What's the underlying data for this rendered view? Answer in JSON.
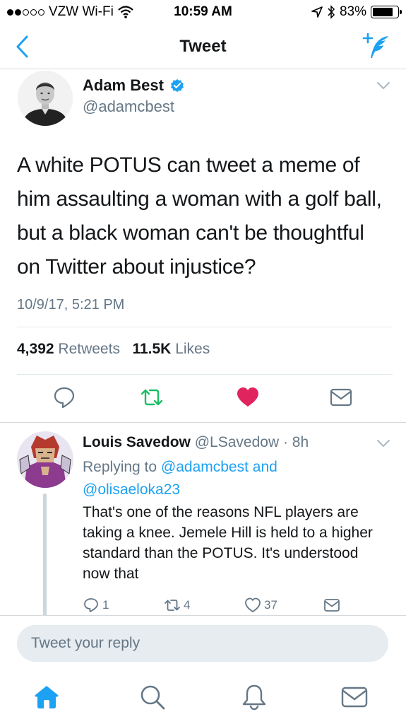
{
  "status_bar": {
    "carrier": "VZW Wi-Fi",
    "time": "10:59 AM",
    "battery": "83%",
    "battery_level": 0.83,
    "signal_full_dots": 2,
    "signal_total_dots": 5
  },
  "nav": {
    "title": "Tweet",
    "back_icon": "chevron-left-icon",
    "compose_icon": "compose-tweet-icon"
  },
  "main_tweet": {
    "name": "Adam Best",
    "handle": "@adamcbest",
    "text": "A white POTUS can tweet a meme of him assaulting a woman with a golf ball, but a black woman can't be thoughtful on Twitter about injustice?",
    "timestamp": "10/9/17, 5:21 PM",
    "retweets_count": "4,392",
    "retweets_label": "Retweets",
    "likes_count": "11.5K",
    "likes_label": "Likes",
    "liked": true
  },
  "reply": {
    "name": "Louis Savedow",
    "handle": "@LSavedow",
    "time": "· 8h",
    "replying_prefix": "Replying to",
    "replying_user1": "@adamcbest",
    "replying_and": "and",
    "replying_user2": "@olisaeloka23",
    "text": "That's one of the reasons NFL players are taking a knee. Jemele Hill is held to a higher standard than the POTUS. It's understood now that",
    "replies": "1",
    "retweets": "4",
    "likes": "37"
  },
  "composer": {
    "placeholder": "Tweet your reply"
  },
  "colors": {
    "accent": "#1da1f2",
    "retweet": "#17bf63",
    "like": "#e0245e",
    "muted": "#657786",
    "text": "#14171a"
  },
  "tabbar": {
    "items": [
      "home-icon",
      "search-icon",
      "notifications-icon",
      "messages-icon"
    ],
    "active": "home-icon"
  }
}
